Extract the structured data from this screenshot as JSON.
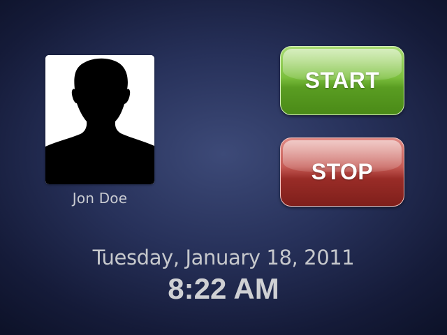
{
  "user": {
    "name": "Jon Doe",
    "avatar_icon": "person-silhouette-icon"
  },
  "controls": {
    "start_label": "START",
    "stop_label": "STOP",
    "start_color": "#6db033",
    "stop_color": "#a3322c"
  },
  "clock": {
    "date": "Tuesday, January 18, 2011",
    "time": "8:22 AM"
  }
}
